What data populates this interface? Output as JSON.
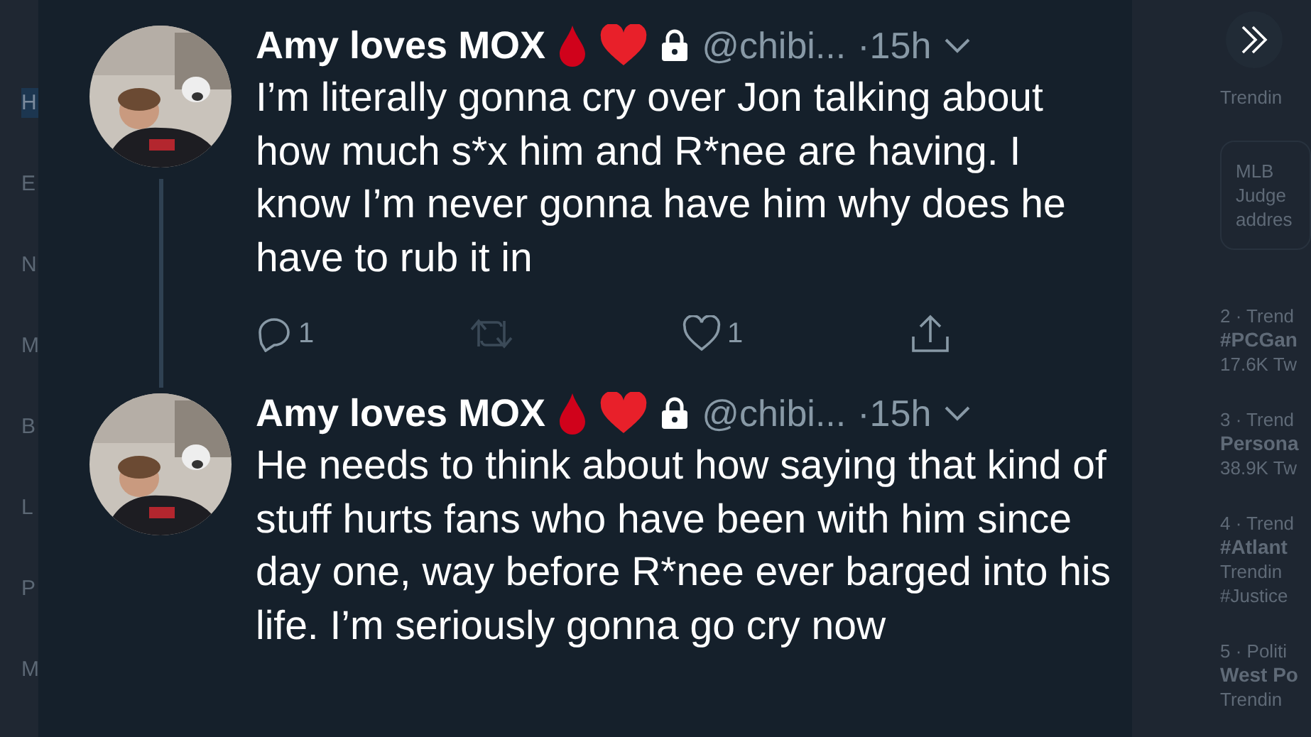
{
  "sidebar": {
    "items": [
      {
        "label": "H",
        "selected": true
      },
      {
        "label": "E",
        "selected": false
      },
      {
        "label": "N",
        "selected": false
      },
      {
        "label": "M",
        "selected": false
      },
      {
        "label": "B",
        "selected": false
      },
      {
        "label": "L",
        "selected": false
      },
      {
        "label": "P",
        "selected": false
      },
      {
        "label": "M",
        "selected": false
      }
    ]
  },
  "thread": [
    {
      "name": "Amy loves MOX",
      "handle": "@chibi...",
      "time": "·15h",
      "text": "I’m literally gonna cry over Jon talking about how much s*x him and R*nee are having. I know I’m never gonna have him why does he have to rub it in",
      "replies": "1",
      "likes": "1"
    },
    {
      "name": "Amy loves MOX",
      "handle": "@chibi...",
      "time": "·15h",
      "text": "He needs to think about how saying that kind of stuff hurts fans who have been with him since day one, way before R*nee ever barged into his life. I’m seriously gonna go cry now"
    }
  ],
  "trends": [
    {
      "context": "Trendin"
    },
    {
      "kind": "card",
      "category": "MLB",
      "headline": "Judge",
      "detail": "addres"
    },
    {
      "context": "2 · Trend",
      "title": "#PCGan",
      "meta": "17.6K Tw"
    },
    {
      "context": "3 · Trend",
      "title": "Persona",
      "meta": "38.9K Tw"
    },
    {
      "context": "4 · Trend",
      "title": "#Atlant",
      "meta": "Trendin",
      "extra": "#Justice"
    },
    {
      "context": "5 · Politi",
      "title": "West Po",
      "meta": "Trendin"
    }
  ]
}
